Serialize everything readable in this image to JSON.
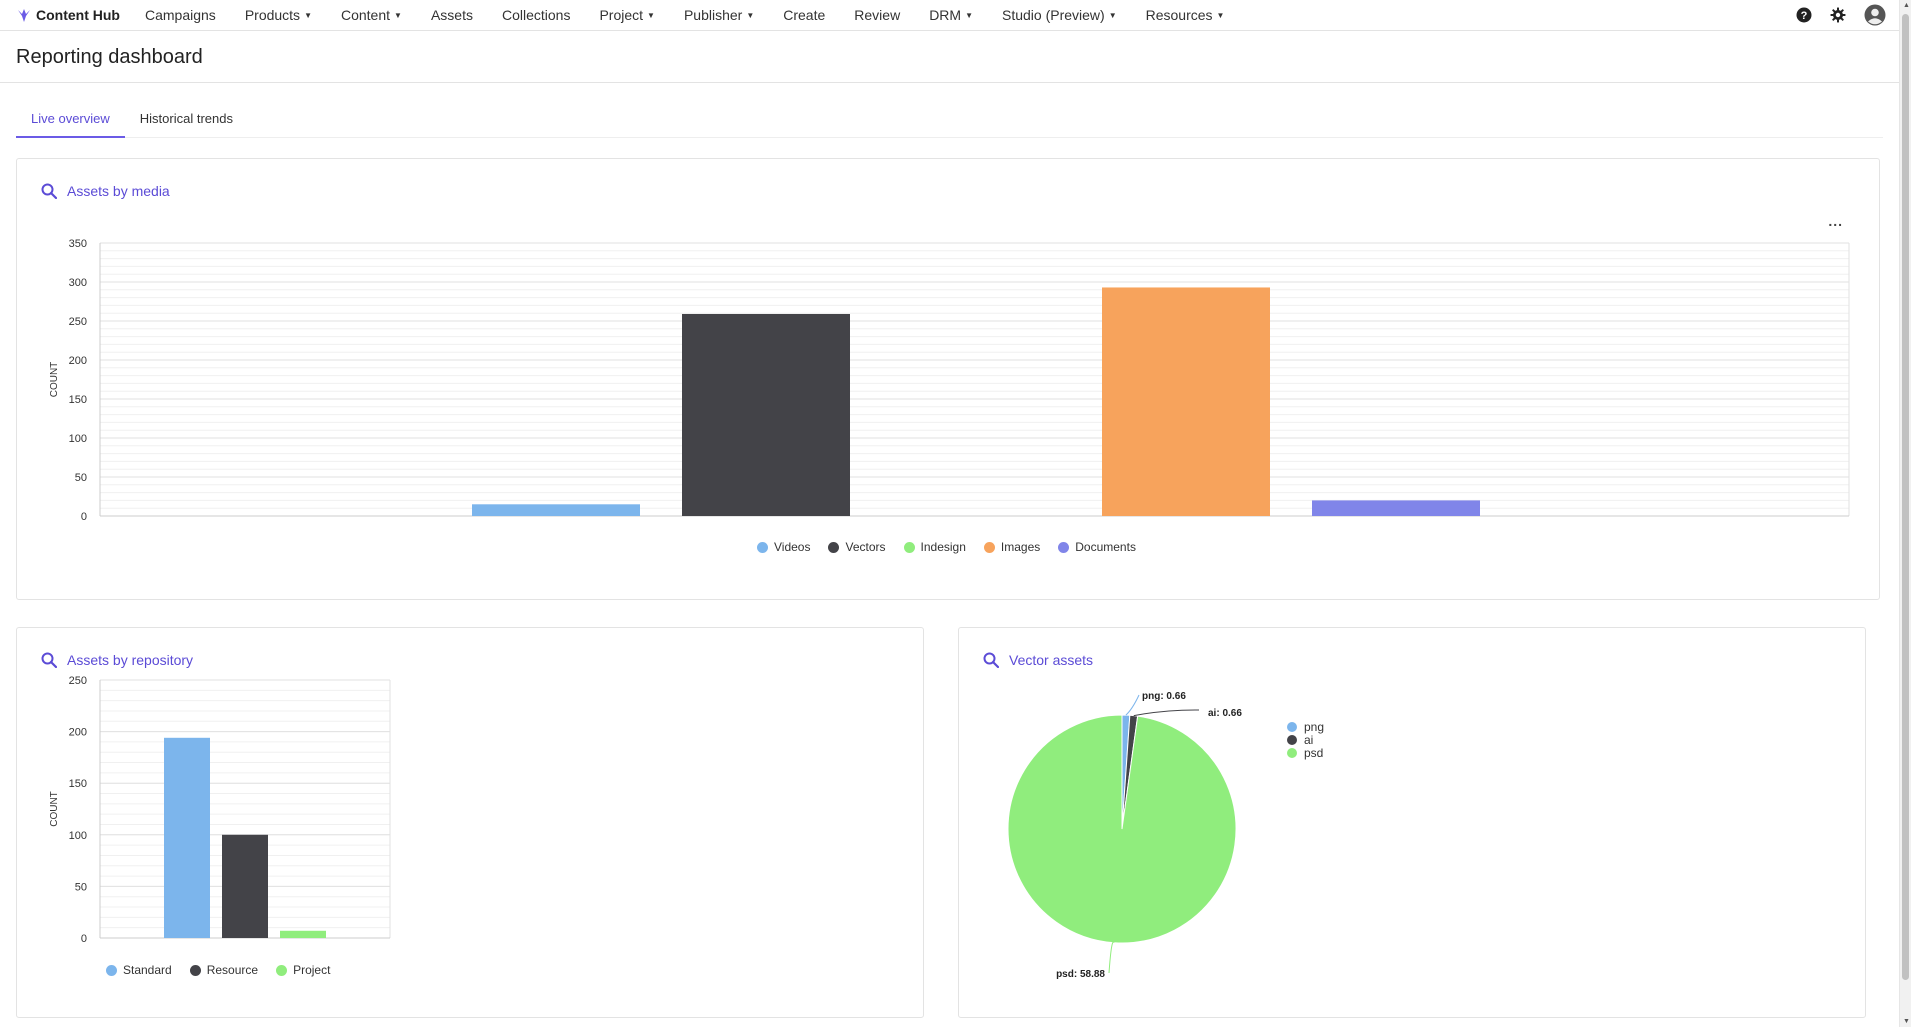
{
  "nav": {
    "brand": "Content Hub",
    "items": [
      {
        "label": "Campaigns",
        "caret": false
      },
      {
        "label": "Products",
        "caret": true
      },
      {
        "label": "Content",
        "caret": true
      },
      {
        "label": "Assets",
        "caret": false
      },
      {
        "label": "Collections",
        "caret": false
      },
      {
        "label": "Project",
        "caret": true
      },
      {
        "label": "Publisher",
        "caret": true
      },
      {
        "label": "Create",
        "caret": false
      },
      {
        "label": "Review",
        "caret": false
      },
      {
        "label": "DRM",
        "caret": true
      },
      {
        "label": "Studio (Preview)",
        "caret": true
      },
      {
        "label": "Resources",
        "caret": true
      }
    ],
    "icons": [
      "help-icon",
      "gear-icon",
      "user-avatar-icon"
    ]
  },
  "page": {
    "title": "Reporting dashboard"
  },
  "tabs": [
    {
      "label": "Live overview",
      "active": true
    },
    {
      "label": "Historical trends",
      "active": false
    }
  ],
  "colors": {
    "accent": "#5b4bd6",
    "videos": "#7cb5ec",
    "vectors": "#434348",
    "indesign": "#90ed7d",
    "images": "#f7a35c",
    "documents": "#8085e9"
  },
  "cards": {
    "media": {
      "title": "Assets by media",
      "menu": "..."
    },
    "repository": {
      "title": "Assets by repository"
    },
    "vector": {
      "title": "Vector assets"
    }
  },
  "chart_data": [
    {
      "type": "bar",
      "title": "Assets by media",
      "ylabel": "COUNT",
      "ylim": [
        0,
        350
      ],
      "yticks": [
        0,
        50,
        100,
        150,
        200,
        250,
        300,
        350
      ],
      "categories": [
        "Videos",
        "Vectors",
        "Indesign",
        "Images",
        "Documents"
      ],
      "values": [
        15,
        259,
        0,
        293,
        20
      ],
      "colors": [
        "#7cb5ec",
        "#434348",
        "#90ed7d",
        "#f7a35c",
        "#8085e9"
      ],
      "legend": "bottom"
    },
    {
      "type": "bar",
      "title": "Assets by repository",
      "ylabel": "COUNT",
      "ylim": [
        0,
        250
      ],
      "yticks": [
        0,
        50,
        100,
        150,
        200,
        250
      ],
      "categories": [
        "Standard",
        "Resource",
        "Project"
      ],
      "values": [
        194,
        100,
        7
      ],
      "colors": [
        "#7cb5ec",
        "#434348",
        "#90ed7d"
      ],
      "legend": "bottom"
    },
    {
      "type": "pie",
      "title": "Vector assets",
      "labels": [
        "png",
        "ai",
        "psd"
      ],
      "values": [
        0.66,
        0.66,
        58.88
      ],
      "data_labels": [
        "png: 0.66",
        "ai: 0.66",
        "psd: 58.88"
      ],
      "colors": [
        "#7cb5ec",
        "#434348",
        "#90ed7d"
      ],
      "legend": "right"
    }
  ]
}
